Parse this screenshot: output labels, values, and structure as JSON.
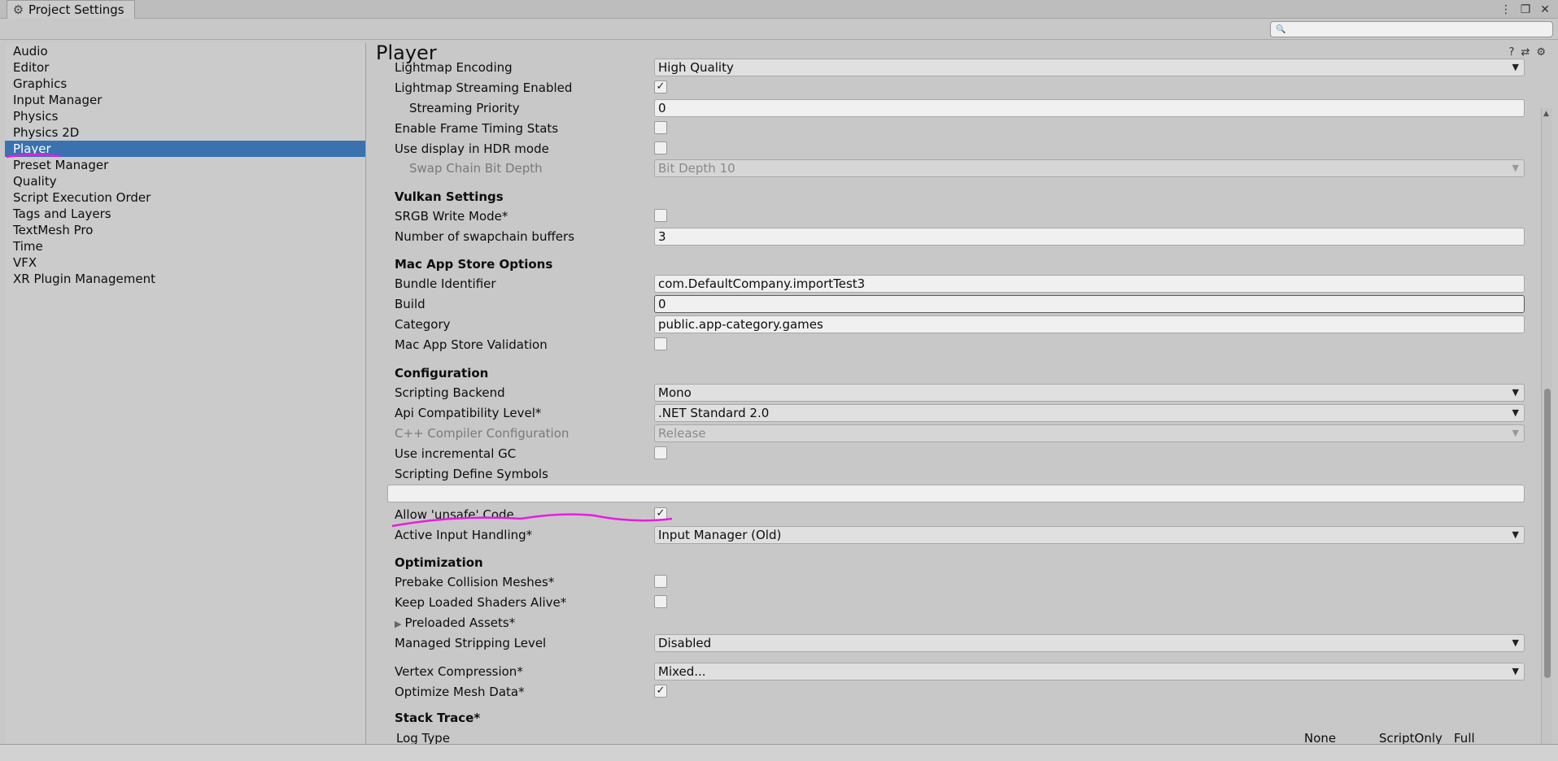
{
  "window": {
    "tab_title": "Project Settings",
    "tab_icon": "gear-icon",
    "controls": [
      "⋮",
      "❐",
      "✕"
    ]
  },
  "search": {
    "placeholder": "",
    "icon": "search-icon"
  },
  "sidebar": {
    "items": [
      {
        "label": "Audio"
      },
      {
        "label": "Editor"
      },
      {
        "label": "Graphics"
      },
      {
        "label": "Input Manager"
      },
      {
        "label": "Physics"
      },
      {
        "label": "Physics 2D"
      },
      {
        "label": "Player",
        "selected": true
      },
      {
        "label": "Preset Manager"
      },
      {
        "label": "Quality"
      },
      {
        "label": "Script Execution Order"
      },
      {
        "label": "Tags and Layers"
      },
      {
        "label": "TextMesh Pro"
      },
      {
        "label": "Time"
      },
      {
        "label": "VFX"
      },
      {
        "label": "XR Plugin Management"
      }
    ]
  },
  "main": {
    "title": "Player",
    "lightmap_encoding": {
      "label": "Lightmap Encoding",
      "value": "High Quality"
    },
    "lightmap_streaming": {
      "label": "Lightmap Streaming Enabled",
      "checked": true
    },
    "streaming_priority": {
      "label": "Streaming Priority",
      "value": "0"
    },
    "frame_timing": {
      "label": "Enable Frame Timing Stats",
      "checked": false
    },
    "hdr_mode": {
      "label": "Use display in HDR mode",
      "checked": false
    },
    "swap_chain": {
      "label": "Swap Chain Bit Depth",
      "value": "Bit Depth 10"
    },
    "vulkan": {
      "header": "Vulkan Settings",
      "srgb": {
        "label": "SRGB Write Mode*",
        "checked": false
      },
      "swapchain_buffers": {
        "label": "Number of swapchain buffers",
        "value": "3"
      }
    },
    "mac_app_store": {
      "header": "Mac App Store Options",
      "bundle_id": {
        "label": "Bundle Identifier",
        "value": "com.DefaultCompany.importTest3"
      },
      "build": {
        "label": "Build",
        "value": "0"
      },
      "category": {
        "label": "Category",
        "value": "public.app-category.games"
      },
      "validation": {
        "label": "Mac App Store Validation",
        "checked": false
      }
    },
    "configuration": {
      "header": "Configuration",
      "scripting_backend": {
        "label": "Scripting Backend",
        "value": "Mono"
      },
      "api_level": {
        "label": "Api Compatibility Level*",
        "value": ".NET Standard 2.0"
      },
      "cpp_config": {
        "label": "C++ Compiler Configuration",
        "value": "Release"
      },
      "incremental_gc": {
        "label": "Use incremental GC",
        "checked": false
      },
      "define_symbols": {
        "label": "Scripting Define Symbols",
        "value": ""
      },
      "unsafe_code": {
        "label": "Allow 'unsafe' Code",
        "checked": true
      },
      "input_handling": {
        "label": "Active Input Handling*",
        "value": "Input Manager (Old)"
      }
    },
    "optimization": {
      "header": "Optimization",
      "prebake": {
        "label": "Prebake Collision Meshes*",
        "checked": false
      },
      "shaders_alive": {
        "label": "Keep Loaded Shaders Alive*",
        "checked": false
      },
      "preloaded_assets": {
        "label": "Preloaded Assets*"
      },
      "stripping": {
        "label": "Managed Stripping Level",
        "value": "Disabled"
      },
      "vertex_compression": {
        "label": "Vertex Compression*",
        "value": "Mixed..."
      },
      "optimize_mesh": {
        "label": "Optimize Mesh Data*",
        "checked": true
      }
    },
    "stack_trace": {
      "header": "Stack Trace*",
      "log_type": "Log Type",
      "columns": [
        "None",
        "ScriptOnly",
        "Full"
      ]
    }
  },
  "colors": {
    "selection": "#3a72b0",
    "annotation": "#e81ce0"
  }
}
